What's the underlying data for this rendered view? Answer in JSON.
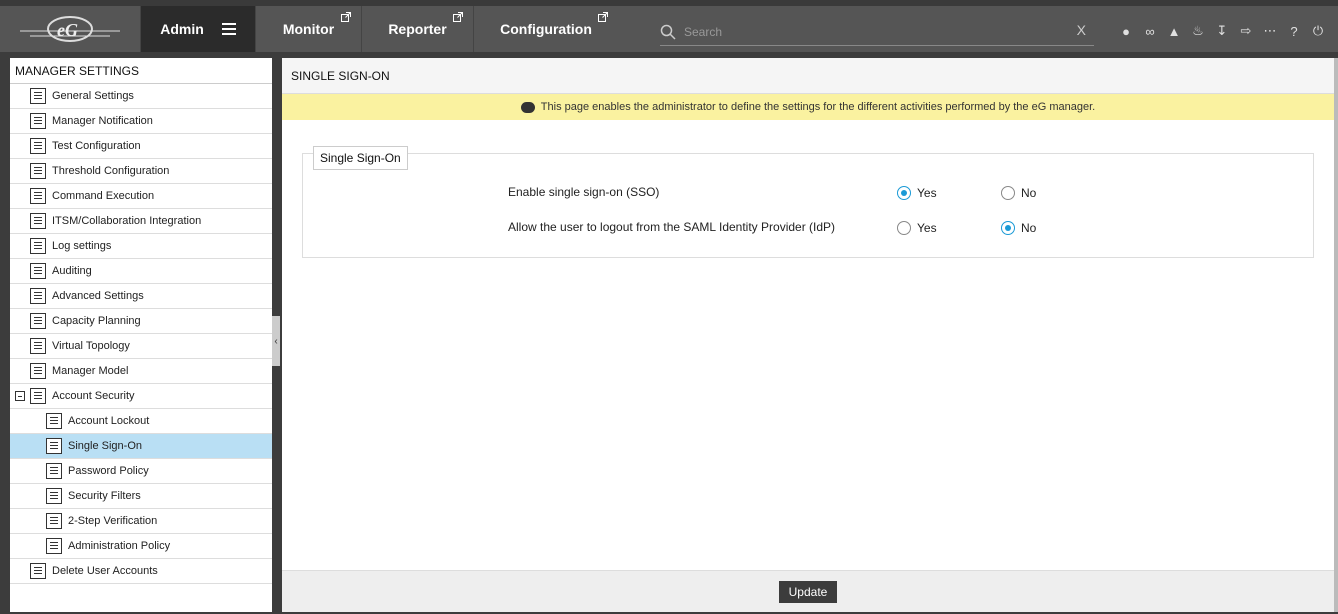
{
  "logo": {
    "text": "eG"
  },
  "nav": {
    "admin": "Admin",
    "monitor": "Monitor",
    "reporter": "Reporter",
    "configuration": "Configuration"
  },
  "search": {
    "placeholder": "Search",
    "clear": "X"
  },
  "toolbar_icons": [
    "user-icon",
    "link-icon",
    "alert-icon",
    "bell-icon",
    "download-icon",
    "signin-icon",
    "more-icon",
    "help-icon",
    "power-icon"
  ],
  "sidebar": {
    "title": "MANAGER SETTINGS",
    "items": [
      {
        "label": "General Settings"
      },
      {
        "label": "Manager Notification"
      },
      {
        "label": "Test Configuration"
      },
      {
        "label": "Threshold Configuration"
      },
      {
        "label": "Command Execution"
      },
      {
        "label": "ITSM/Collaboration Integration"
      },
      {
        "label": "Log settings"
      },
      {
        "label": "Auditing"
      },
      {
        "label": "Advanced Settings"
      },
      {
        "label": "Capacity Planning"
      },
      {
        "label": "Virtual Topology"
      },
      {
        "label": "Manager Model"
      },
      {
        "label": "Account Security"
      },
      {
        "label": "Account Lockout"
      },
      {
        "label": "Single Sign-On"
      },
      {
        "label": "Password Policy"
      },
      {
        "label": "Security Filters"
      },
      {
        "label": "2-Step Verification"
      },
      {
        "label": "Administration Policy"
      },
      {
        "label": "Delete User Accounts"
      }
    ]
  },
  "main": {
    "title": "SINGLE SIGN-ON",
    "info": "This page enables the administrator to define the settings for the different activities performed by the eG manager.",
    "section": "Single Sign-On",
    "q1": {
      "label": "Enable single sign-on (SSO)",
      "yes": "Yes",
      "no": "No",
      "selected": "Yes"
    },
    "q2": {
      "label": "Allow the user to logout from the SAML Identity Provider (IdP)",
      "yes": "Yes",
      "no": "No",
      "selected": "No"
    },
    "update": "Update"
  },
  "colors": {
    "accent": "#1a9ad6",
    "selected_row": "#b9dff4",
    "info_bg": "#faf2a0"
  }
}
